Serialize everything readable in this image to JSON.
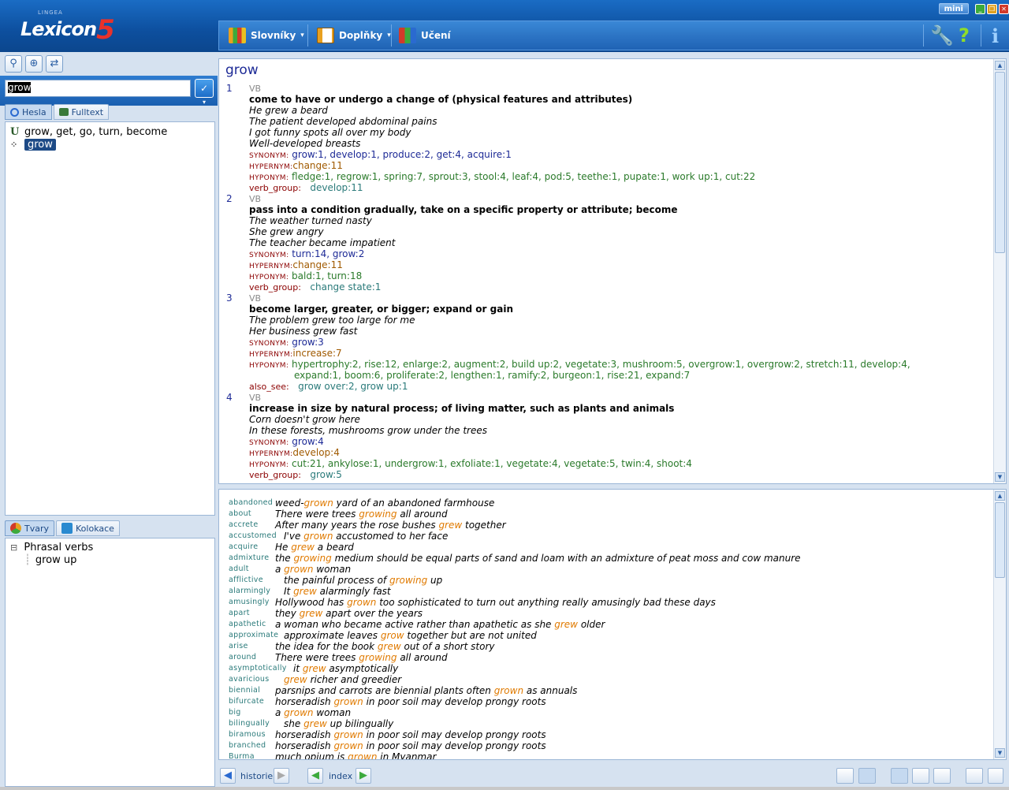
{
  "app": {
    "logo_text": "Lexicon",
    "logo_five": "5",
    "logo_sub": "LINGEA",
    "mini_label": "mini"
  },
  "toolbar": {
    "dicts": "Slovníky",
    "extras": "Doplňky",
    "learn": "Učení"
  },
  "search": {
    "value": "grow",
    "drop": "▾"
  },
  "left_tabs": {
    "entries": "Hesla",
    "fulltext": "Fulltext"
  },
  "entry_list": [
    {
      "icon": "U",
      "text": "grow, get, go, turn, become"
    },
    {
      "icon": "⁘",
      "text": "grow"
    }
  ],
  "lower_tabs": {
    "forms": "Tvary",
    "collocations": "Kolokace"
  },
  "tree": {
    "root": "Phrasal verbs",
    "child": "grow up",
    "toggle": "⊟"
  },
  "entry": {
    "headword": "grow",
    "senses": [
      {
        "num": "1",
        "pos": "VB",
        "def": "come to have or undergo a change of (physical features and attributes)",
        "examples": [
          "He grew a beard",
          "The patient developed abdominal pains",
          "I got funny spots all over my body",
          "Well-developed breasts"
        ],
        "relations": [
          {
            "label": "SYNONYM:",
            "cls": "syn",
            "text": " grow:1, develop:1, produce:2, get:4, acquire:1"
          },
          {
            "label": "HYPERNYM:",
            "cls": "hyper",
            "text": "change:11"
          },
          {
            "label": "HYPONYM:",
            "cls": "hypo",
            "text": " fledge:1, regrow:1, spring:7, sprout:3, stool:4, leaf:4, pod:5, teethe:1, pupate:1, work up:1, cut:22"
          },
          {
            "label": "verb_group:",
            "cls": "vg",
            "text": "   develop:11"
          }
        ]
      },
      {
        "num": "2",
        "pos": "VB",
        "def": "pass into a condition gradually, take on a specific property or attribute; become",
        "examples": [
          "The weather turned nasty",
          "She grew angry",
          "The teacher became impatient"
        ],
        "relations": [
          {
            "label": "SYNONYM:",
            "cls": "syn",
            "text": " turn:14, grow:2"
          },
          {
            "label": "HYPERNYM:",
            "cls": "hyper",
            "text": "change:11"
          },
          {
            "label": "HYPONYM:",
            "cls": "hypo",
            "text": " bald:1, turn:18"
          },
          {
            "label": "verb_group:",
            "cls": "vg",
            "text": "   change state:1"
          }
        ]
      },
      {
        "num": "3",
        "pos": "VB",
        "def": "become larger, greater, or bigger; expand or gain",
        "examples": [
          "The problem grew too large for me",
          "Her business grew fast"
        ],
        "relations": [
          {
            "label": "SYNONYM:",
            "cls": "syn",
            "text": " grow:3"
          },
          {
            "label": "HYPERNYM:",
            "cls": "hyper",
            "text": "increase:7"
          },
          {
            "label": "HYPONYM:",
            "cls": "hypo",
            "text": " hypertrophy:2, rise:12, enlarge:2, augment:2, build up:2, vegetate:3, mushroom:5, overgrow:1, overgrow:2, stretch:11, develop:4,"
          },
          {
            "label": "",
            "cls": "hypo",
            "text": "expand:1, boom:6, proliferate:2, lengthen:1, ramify:2, burgeon:1, rise:21, expand:7"
          },
          {
            "label": "also_see:",
            "cls": "vg",
            "text": "   grow over:2, grow up:1"
          }
        ]
      },
      {
        "num": "4",
        "pos": "VB",
        "def": "increase in size by natural process; of living matter, such as plants and animals",
        "examples": [
          "Corn doesn't grow here",
          "In these forests, mushrooms grow under the trees"
        ],
        "relations": [
          {
            "label": "SYNONYM:",
            "cls": "syn",
            "text": " grow:4"
          },
          {
            "label": "HYPERNYM:",
            "cls": "hyper",
            "text": "develop:4"
          },
          {
            "label": "HYPONYM:",
            "cls": "hypo",
            "text": " cut:21, ankylose:1, undergrow:1, exfoliate:1, vegetate:4, vegetate:5, twin:4, shoot:4"
          },
          {
            "label": "verb_group:",
            "cls": "vg",
            "text": "   grow:5"
          }
        ]
      }
    ]
  },
  "collocations": [
    {
      "word": "abandoned",
      "pre": "weed-",
      "hl": "grown",
      "post": " yard of an abandoned farmhouse"
    },
    {
      "word": "about",
      "pre": "There were trees ",
      "hl": "growing",
      "post": " all around"
    },
    {
      "word": "accrete",
      "pre": "After many years the rose bushes ",
      "hl": "grew",
      "post": " together"
    },
    {
      "word": "accustomed",
      "pre": "I've ",
      "hl": "grown",
      "post": " accustomed to her face"
    },
    {
      "word": "acquire",
      "pre": "He ",
      "hl": "grew",
      "post": " a beard"
    },
    {
      "word": "admixture",
      "pre": "the ",
      "hl": "growing",
      "post": " medium should be equal parts of sand and loam with an admixture of peat moss and cow manure"
    },
    {
      "word": "adult",
      "pre": "a ",
      "hl": "grown",
      "post": " woman"
    },
    {
      "word": "afflictive",
      "pre": "the painful process of ",
      "hl": "growing",
      "post": " up"
    },
    {
      "word": "alarmingly",
      "pre": "It ",
      "hl": "grew",
      "post": " alarmingly fast"
    },
    {
      "word": "amusingly",
      "pre": "Hollywood has ",
      "hl": "grown",
      "post": " too sophisticated to turn out anything really amusingly bad these days"
    },
    {
      "word": "apart",
      "pre": "they ",
      "hl": "grew",
      "post": " apart over the years"
    },
    {
      "word": "apathetic",
      "pre": "a woman who became active rather than apathetic as she ",
      "hl": "grew",
      "post": " older"
    },
    {
      "word": "approximate",
      "pre": "approximate leaves ",
      "hl": "grow",
      "post": " together but are not united"
    },
    {
      "word": "arise",
      "pre": "the idea for the book ",
      "hl": "grew",
      "post": " out of a short story"
    },
    {
      "word": "around",
      "pre": "There were trees ",
      "hl": "growing",
      "post": " all around"
    },
    {
      "word": "asymptotically",
      "pre": "it ",
      "hl": "grew",
      "post": " asymptotically"
    },
    {
      "word": "avaricious",
      "pre": "",
      "hl": "grew",
      "post": " richer and greedier"
    },
    {
      "word": "biennial",
      "pre": "parsnips and carrots are biennial plants often ",
      "hl": "grown",
      "post": " as annuals"
    },
    {
      "word": "bifurcate",
      "pre": "horseradish ",
      "hl": "grown",
      "post": " in poor soil may develop prongy roots"
    },
    {
      "word": "big",
      "pre": "a ",
      "hl": "grown",
      "post": " woman"
    },
    {
      "word": "bilingually",
      "pre": "she ",
      "hl": "grew",
      "post": " up bilingually"
    },
    {
      "word": "biramous",
      "pre": "horseradish ",
      "hl": "grown",
      "post": " in poor soil may develop prongy roots"
    },
    {
      "word": "branched",
      "pre": "horseradish ",
      "hl": "grown",
      "post": " in poor soil may develop prongy roots"
    },
    {
      "word": "Burma",
      "pre": "much opium is ",
      "hl": "grown",
      "post": " in Myanmar"
    }
  ],
  "bottom": {
    "history": "historie",
    "index": "index"
  }
}
